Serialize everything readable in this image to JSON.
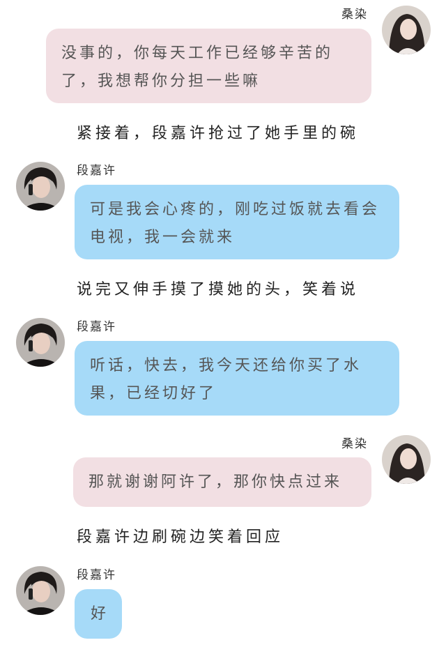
{
  "messages": [
    {
      "name": "桑染",
      "text": "没事的，你每天工作已经够辛苦的了，我想帮你分担一些嘛"
    },
    {
      "narration": "紧接着，段嘉许抢过了她手里的碗"
    },
    {
      "name": "段嘉许",
      "text": "可是我会心疼的，刚吃过饭就去看会电视，我一会就来"
    },
    {
      "narration": "说完又伸手摸了摸她的头，笑着说"
    },
    {
      "name": "段嘉许",
      "text": "听话，快去，我今天还给你买了水果，已经切好了"
    },
    {
      "name": "桑染",
      "text": "那就谢谢阿许了，那你快点过来"
    },
    {
      "narration": "段嘉许边刷碗边笑着回应"
    },
    {
      "name": "段嘉许",
      "text": "好"
    }
  ],
  "colors": {
    "left_bubble": "#a6daf8",
    "right_bubble": "#f2dfe3"
  },
  "icons": {
    "left_avatar": "male-avatar-icon",
    "right_avatar": "female-avatar-icon"
  }
}
